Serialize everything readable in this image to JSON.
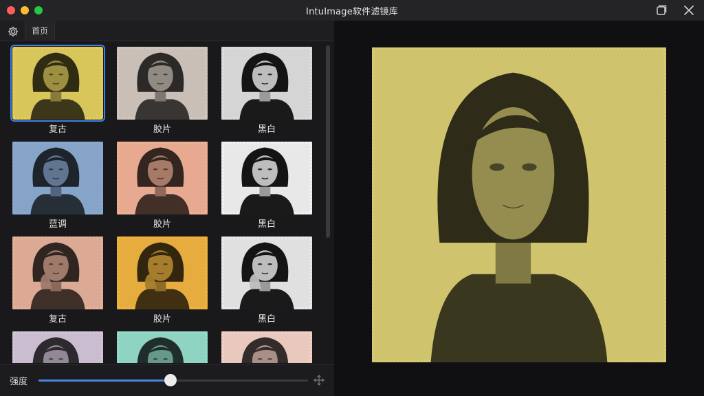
{
  "window": {
    "title": "IntuImage软件滤镜库"
  },
  "tabs": {
    "home_label": "首页"
  },
  "filters": [
    {
      "label": "复古",
      "tint": "#d8c65a",
      "pose": "portrait",
      "selected": true
    },
    {
      "label": "胶片",
      "tint": "#c9bfb6",
      "pose": "portrait",
      "selected": false
    },
    {
      "label": "黑白",
      "tint": "#d5d5d5",
      "pose": "portrait-bw",
      "selected": false
    },
    {
      "label": "蓝调",
      "tint": "#86a3c8",
      "pose": "portrait",
      "selected": false
    },
    {
      "label": "胶片",
      "tint": "#e7a98f",
      "pose": "portrait",
      "selected": false
    },
    {
      "label": "黑白",
      "tint": "#e8e8e8",
      "pose": "portrait-bw",
      "selected": false
    },
    {
      "label": "复古",
      "tint": "#dcaa94",
      "pose": "hand",
      "selected": false
    },
    {
      "label": "胶片",
      "tint": "#e6ad3e",
      "pose": "hand",
      "selected": false
    },
    {
      "label": "黑白",
      "tint": "#e0e0e0",
      "pose": "hand-bw",
      "selected": false
    },
    {
      "label": "",
      "tint": "#cbbdd0",
      "pose": "portrait",
      "selected": false
    },
    {
      "label": "",
      "tint": "#8fd3c3",
      "pose": "portrait",
      "selected": false
    },
    {
      "label": "",
      "tint": "#e9c8bd",
      "pose": "portrait",
      "selected": false
    }
  ],
  "controls": {
    "intensity_label": "强度",
    "intensity_value": 0.49
  },
  "preview": {
    "filter": "复古",
    "tint": "#cfc36e"
  },
  "colors": {
    "accent": "#4a86e6",
    "selection": "#3f7fe8"
  }
}
